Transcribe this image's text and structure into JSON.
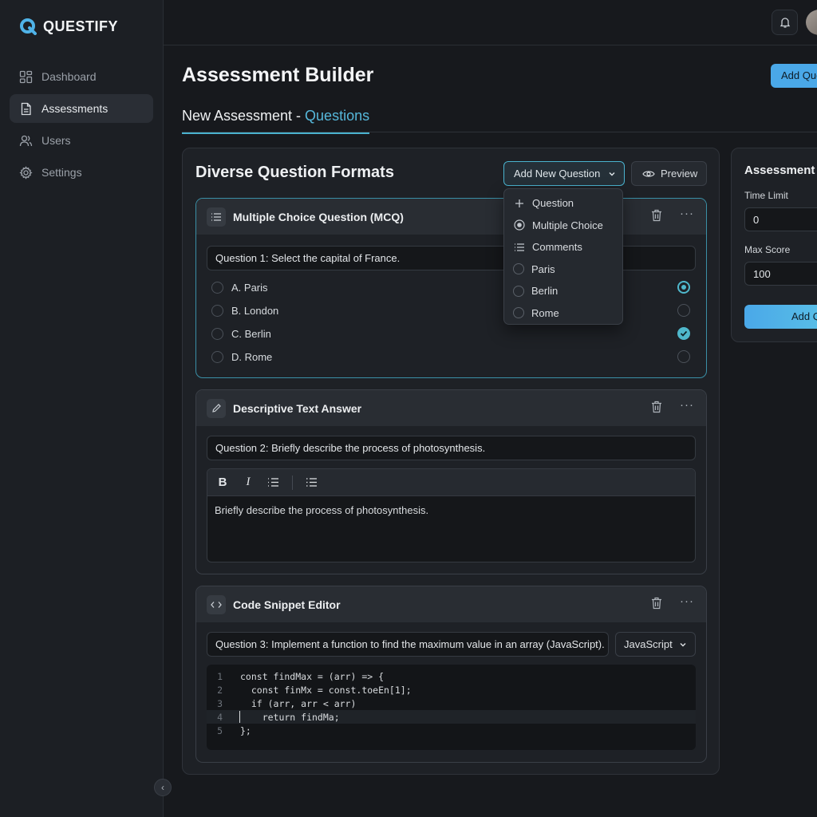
{
  "app": {
    "name": "QUESTIFY"
  },
  "sidebar": {
    "items": [
      {
        "label": "Dashboard",
        "icon": "grid-icon",
        "active": false
      },
      {
        "label": "Assessments",
        "icon": "document-icon",
        "active": true
      },
      {
        "label": "Users",
        "icon": "users-icon",
        "active": false
      },
      {
        "label": "Settings",
        "icon": "gear-icon",
        "active": false
      }
    ]
  },
  "header": {
    "title": "Assessment Builder",
    "add_question_label": "Add Questi",
    "subtab_prefix": "New Assessment - ",
    "subtab_accent": "Questions"
  },
  "panel": {
    "title": "Diverse Question Formats",
    "add_new_label": "Add New Question",
    "preview_label": "Preview"
  },
  "dropdown": {
    "items": [
      {
        "label": "Question",
        "icon": "plus-icon"
      },
      {
        "label": "Multiple Choice",
        "icon": "radio-circle-icon"
      },
      {
        "label": "Comments",
        "icon": "list-icon"
      },
      {
        "label": "Paris",
        "icon": "radio-empty-icon"
      },
      {
        "label": "Berlin",
        "icon": "radio-empty-icon"
      },
      {
        "label": "Rome",
        "icon": "radio-empty-icon"
      }
    ]
  },
  "mcq": {
    "title": "Multiple Choice Question (MCQ)",
    "question": "Question 1: Select the capital of France.",
    "options": [
      {
        "label": "A. Paris",
        "state": "selected"
      },
      {
        "label": "B. London",
        "state": "empty"
      },
      {
        "label": "C. Berlin",
        "state": "checked"
      },
      {
        "label": "D. Rome",
        "state": "empty"
      }
    ]
  },
  "descriptive": {
    "title": "Descriptive Text Answer",
    "question": "Question 2: Briefly describe the process of photosynthesis.",
    "toolbar": {
      "bold": "B",
      "italic": "I"
    },
    "body": "Briefly describe the process of photosynthesis."
  },
  "code": {
    "title": "Code Snippet Editor",
    "question": "Question 3: Implement a function to find the maximum value in an array (JavaScript).",
    "language": "JavaScript",
    "lines": [
      {
        "num": "1",
        "text": "const findMax = (arr) => {"
      },
      {
        "num": "2",
        "text": "  const finMx = const.toeEn[1];"
      },
      {
        "num": "3",
        "text": "  if (arr, arr < arr)"
      },
      {
        "num": "4",
        "text": "    return findMa;"
      },
      {
        "num": "5",
        "text": "};"
      }
    ]
  },
  "settings": {
    "title": "Assessment",
    "time_limit_label": "Time Limit",
    "time_limit_value": "0",
    "max_score_label": "Max Score",
    "max_score_value": "100",
    "button_label": "Add Q"
  },
  "colors": {
    "accent": "#4ab3cf",
    "primary_button": "#4aa8e8",
    "background": "#17191d"
  }
}
